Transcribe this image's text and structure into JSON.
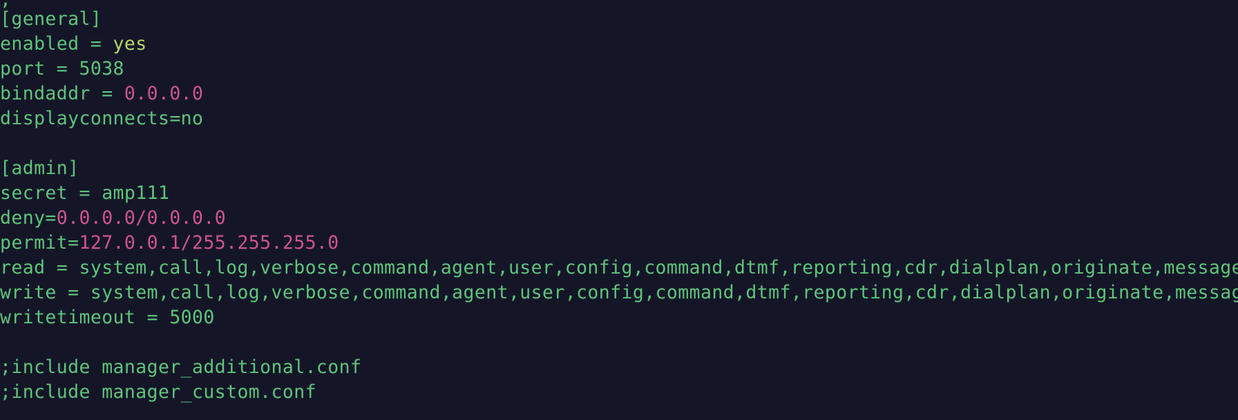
{
  "colors": {
    "background": "#141628",
    "text": "#5fc47a",
    "ip_address": "#d0548f",
    "boolean_yes": "#b6d66a"
  },
  "lines": [
    {
      "name": "comment-line",
      "segments": [
        ";"
      ]
    },
    {
      "name": "section-general",
      "segments": [
        "[general]"
      ]
    },
    {
      "name": "enabled-line",
      "segments": [
        "enabled = ",
        "yes"
      ]
    },
    {
      "name": "port-line",
      "segments": [
        "port = 5038"
      ]
    },
    {
      "name": "bindaddr-line",
      "segments": [
        "bindaddr = ",
        "0.0.0.0"
      ]
    },
    {
      "name": "displayconnects-line",
      "segments": [
        "displayconnects=no"
      ]
    },
    {
      "name": "blank-line-1",
      "segments": [
        ""
      ]
    },
    {
      "name": "section-admin",
      "segments": [
        "[admin]"
      ]
    },
    {
      "name": "secret-line",
      "segments": [
        "secret = amp111"
      ]
    },
    {
      "name": "deny-line",
      "segments": [
        "deny=",
        "0.0.0.0/0.0.0.0"
      ]
    },
    {
      "name": "permit-line",
      "segments": [
        "permit=",
        "127.0.0.1/255.255.255.0"
      ]
    },
    {
      "name": "read-line",
      "segments": [
        "read = system,call,log,verbose,command,agent,user,config,command,dtmf,reporting,cdr,dialplan,originate,message"
      ]
    },
    {
      "name": "write-line",
      "segments": [
        "write = system,call,log,verbose,command,agent,user,config,command,dtmf,reporting,cdr,dialplan,originate,message"
      ]
    },
    {
      "name": "writetimeout-line",
      "segments": [
        "writetimeout = 5000"
      ]
    },
    {
      "name": "blank-line-2",
      "segments": [
        ""
      ]
    },
    {
      "name": "include-additional-line",
      "segments": [
        ";include manager_additional.conf"
      ]
    },
    {
      "name": "include-custom-line",
      "segments": [
        ";include manager_custom.conf"
      ]
    }
  ]
}
